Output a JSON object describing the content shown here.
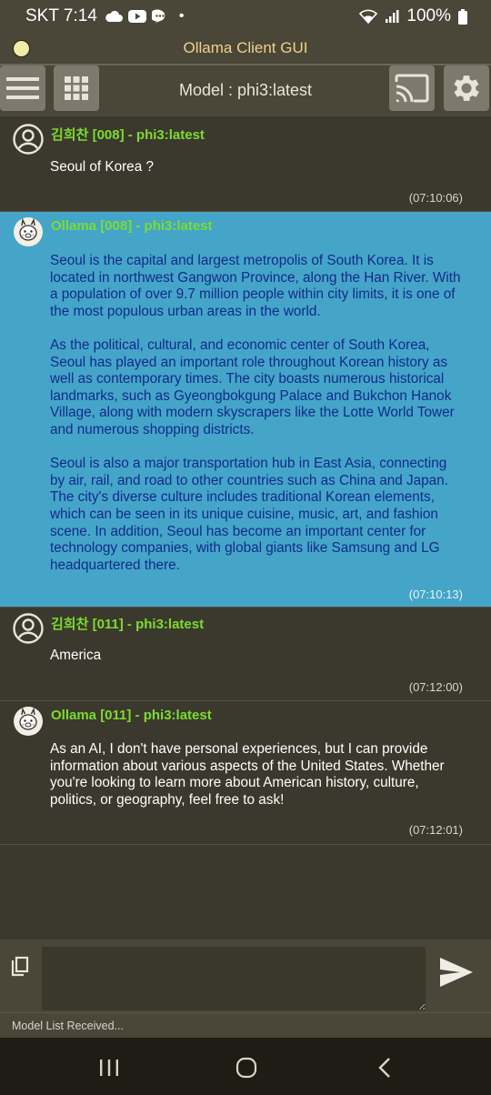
{
  "status_bar": {
    "carrier_time": "SKT 7:14",
    "dot": "•",
    "battery": "100%",
    "icons": [
      "cloud-icon",
      "youtube-icon",
      "chat-bubble-icon",
      "wifi-icon",
      "signal-icon",
      "battery-icon"
    ]
  },
  "app": {
    "title": "Ollama Client GUI"
  },
  "toolbar": {
    "model_label": "Model : phi3:latest",
    "buttons": [
      "menu-icon",
      "grid-icon",
      "cast-icon",
      "gear-icon"
    ]
  },
  "messages": [
    {
      "role": "user",
      "sender": "김희찬  [008] - phi3:latest",
      "text": "Seoul of Korea ?",
      "time": "(07:10:06)"
    },
    {
      "role": "assistant",
      "sender": "Ollama  [008] - phi3:latest",
      "text": "Seoul is the capital and largest metropolis of South Korea. It is located in northwest Gangwon Province, along the Han River. With a population of over 9.7 million people within city limits, it is one of the most populous urban areas in the world.\n\nAs the political, cultural, and economic center of South Korea, Seoul has played an important role throughout Korean history as well as contemporary times. The city boasts numerous historical landmarks, such as Gyeongbokgung Palace and Bukchon Hanok Village, along with modern skyscrapers like the Lotte World Tower and numerous shopping districts.\n\nSeoul is also a major transportation hub in East Asia, connecting by air, rail, and road to other countries such as China and Japan. The city's diverse culture includes traditional Korean elements, which can be seen in its unique cuisine, music, art, and fashion scene. In addition, Seoul has become an important center for technology companies, with global giants like Samsung and LG headquartered there.",
      "time": "(07:10:13)"
    },
    {
      "role": "user",
      "sender": "김희찬  [011] - phi3:latest",
      "text": "America",
      "time": "(07:12:00)"
    },
    {
      "role": "assistant",
      "sender": "Ollama  [011] - phi3:latest",
      "text": "As an AI, I don't have personal experiences, but I can provide information about various aspects of the United States. Whether you're looking to learn more about American history, culture, politics, or geography, feel free to ask!",
      "time": "(07:12:01)"
    }
  ],
  "input": {
    "value": "",
    "placeholder": ""
  },
  "status_message": "Model List Received...",
  "nav_bar": [
    "recents-icon",
    "home-icon",
    "back-icon"
  ]
}
